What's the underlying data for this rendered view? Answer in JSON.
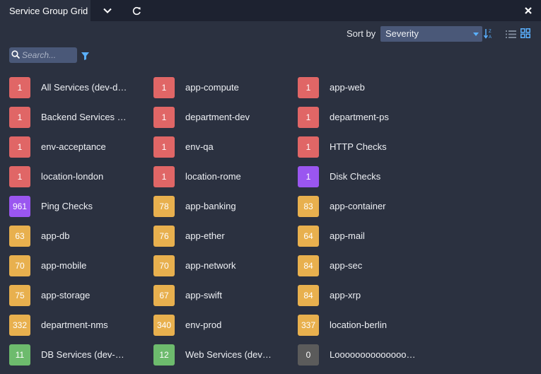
{
  "header": {
    "title": "Service Group Grid",
    "menu_icon": "chevron-down-icon",
    "refresh_icon": "refresh-icon",
    "close_icon": "close-icon"
  },
  "toolbar": {
    "sort_label": "Sort by",
    "sort_value": "Severity",
    "sort_direction_icon": "sort-descending-icon",
    "list_view_icon": "list-view-icon",
    "grid_view_icon": "grid-view-icon",
    "active_view": "grid"
  },
  "search": {
    "placeholder": "Search...",
    "value": ""
  },
  "colors": {
    "critical": "#e06666",
    "warning": "#e8b04e",
    "ok": "#6dbb6d",
    "info": "#9a56f0",
    "unknown": "#5b5b5b",
    "accent": "#5ab0ff"
  },
  "groups": [
    {
      "count": "1",
      "name": "All Services (dev-do…",
      "status": "critical"
    },
    {
      "count": "1",
      "name": "app-compute",
      "status": "critical"
    },
    {
      "count": "1",
      "name": "app-web",
      "status": "critical"
    },
    {
      "count": "1",
      "name": "Backend Services (…",
      "status": "critical"
    },
    {
      "count": "1",
      "name": "department-dev",
      "status": "critical"
    },
    {
      "count": "1",
      "name": "department-ps",
      "status": "critical"
    },
    {
      "count": "1",
      "name": "env-acceptance",
      "status": "critical"
    },
    {
      "count": "1",
      "name": "env-qa",
      "status": "critical"
    },
    {
      "count": "1",
      "name": "HTTP Checks",
      "status": "critical"
    },
    {
      "count": "1",
      "name": "location-london",
      "status": "critical"
    },
    {
      "count": "1",
      "name": "location-rome",
      "status": "critical"
    },
    {
      "count": "1",
      "name": "Disk Checks",
      "status": "info"
    },
    {
      "count": "961",
      "name": "Ping Checks",
      "status": "info"
    },
    {
      "count": "78",
      "name": "app-banking",
      "status": "warning"
    },
    {
      "count": "83",
      "name": "app-container",
      "status": "warning"
    },
    {
      "count": "63",
      "name": "app-db",
      "status": "warning"
    },
    {
      "count": "76",
      "name": "app-ether",
      "status": "warning"
    },
    {
      "count": "64",
      "name": "app-mail",
      "status": "warning"
    },
    {
      "count": "70",
      "name": "app-mobile",
      "status": "warning"
    },
    {
      "count": "70",
      "name": "app-network",
      "status": "warning"
    },
    {
      "count": "84",
      "name": "app-sec",
      "status": "warning"
    },
    {
      "count": "75",
      "name": "app-storage",
      "status": "warning"
    },
    {
      "count": "67",
      "name": "app-swift",
      "status": "warning"
    },
    {
      "count": "84",
      "name": "app-xrp",
      "status": "warning"
    },
    {
      "count": "332",
      "name": "department-nms",
      "status": "warning"
    },
    {
      "count": "340",
      "name": "env-prod",
      "status": "warning"
    },
    {
      "count": "337",
      "name": "location-berlin",
      "status": "warning"
    },
    {
      "count": "11",
      "name": "DB Services (dev-d…",
      "status": "ok"
    },
    {
      "count": "12",
      "name": "Web Services (dev-…",
      "status": "ok"
    },
    {
      "count": "0",
      "name": "Looooooooooooooo…",
      "status": "unknown"
    }
  ]
}
